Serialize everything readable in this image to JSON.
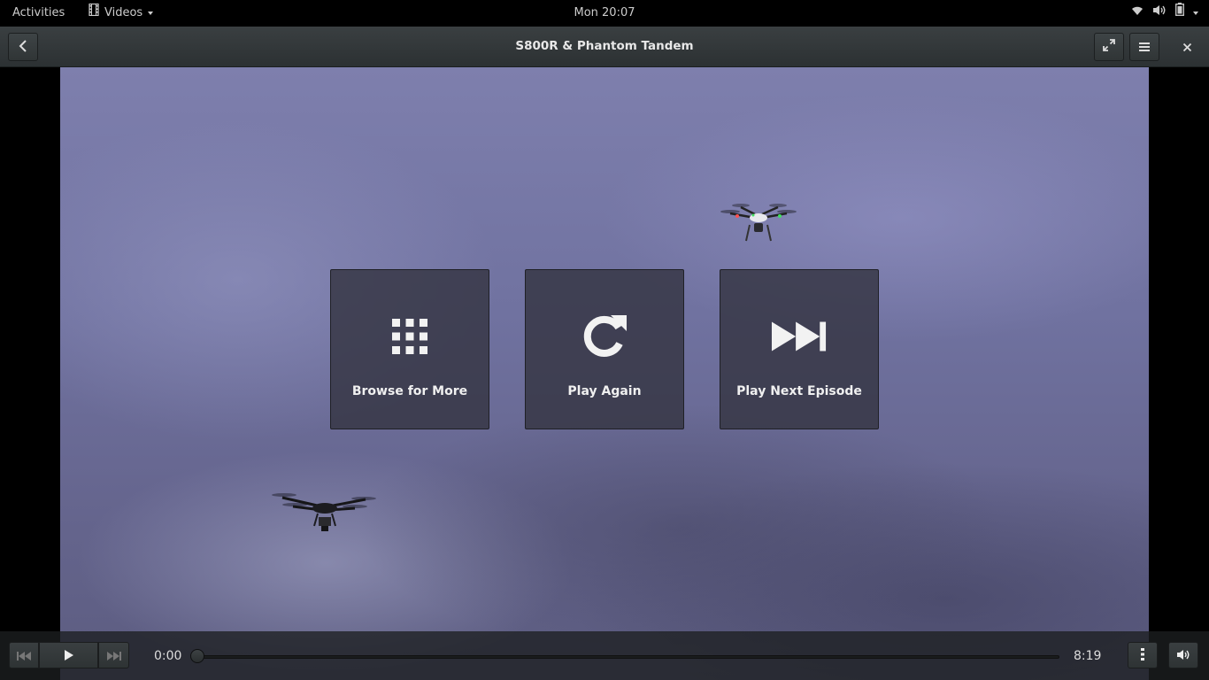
{
  "topbar": {
    "activities": "Activities",
    "app_name": "Videos",
    "app_icon": "film-icon",
    "clock": "Mon 20:07",
    "status_icons": [
      "wifi-icon",
      "volume-icon",
      "battery-icon"
    ]
  },
  "header": {
    "title": "S800R & Phantom Tandem",
    "back_icon": "chevron-left-icon",
    "fullscreen_icon": "fullscreen-icon",
    "menu_icon": "hamburger-menu-icon",
    "close_icon": "close-icon"
  },
  "overlay": {
    "browse_label": "Browse for More",
    "replay_label": "Play Again",
    "next_label": "Play Next Episode"
  },
  "controls": {
    "current_time": "0:00",
    "total_time": "8:19",
    "progress": 0.0,
    "prev_icon": "skip-back-icon",
    "play_icon": "play-icon",
    "next_icon": "skip-forward-icon",
    "more_icon": "vertical-dots-icon",
    "volume_icon": "volume-icon"
  },
  "colors": {
    "headerbar": "#33393b",
    "tile_bg": "#343542",
    "sky": "#7072a0"
  }
}
